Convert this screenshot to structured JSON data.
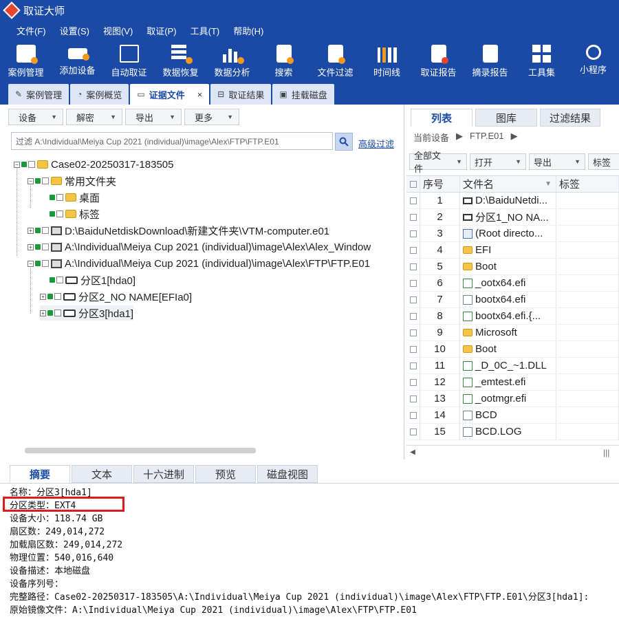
{
  "app": {
    "title": "取证大师"
  },
  "menu": [
    "文件(F)",
    "设置(S)",
    "视图(V)",
    "取证(P)",
    "工具(T)",
    "帮助(H)"
  ],
  "toolbar": [
    "案例管理",
    "添加设备",
    "自动取证",
    "数据恢复",
    "数据分析",
    "搜索",
    "文件过滤",
    "时间线",
    "取证报告",
    "摘录报告",
    "工具集",
    "小程序"
  ],
  "workspace_tabs": [
    {
      "label": "案例管理"
    },
    {
      "label": "案例概览"
    },
    {
      "label": "证据文件",
      "close": "×"
    },
    {
      "label": "取证结果"
    },
    {
      "label": "挂载磁盘"
    }
  ],
  "left": {
    "buttons": [
      "设备",
      "解密",
      "导出",
      "更多"
    ],
    "filter_text": "过滤 A:\\Individual\\Meiya Cup 2021 (individual)\\image\\Alex\\FTP\\FTP.E01",
    "advanced_filter": "高级过滤",
    "tree": [
      "Case02-20250317-183505",
      "常用文件夹",
      "桌面",
      "标签",
      "D:\\BaiduNetdiskDownload\\新建文件夹\\VTM-computer.e01",
      "A:\\Individual\\Meiya Cup 2021 (individual)\\image\\Alex\\Alex_Window",
      "A:\\Individual\\Meiya Cup 2021 (individual)\\image\\Alex\\FTP\\FTP.E01",
      "分区1[hda0]",
      "分区2_NO NAME[EFIa0]",
      "分区3[hda1]"
    ]
  },
  "right": {
    "tabs": [
      "列表",
      "图库",
      "过滤结果"
    ],
    "breadcrumb": {
      "current": "当前设备",
      "item": "FTP.E01"
    },
    "buttons": [
      "全部文件",
      "打开",
      "导出",
      "标签"
    ],
    "columns": {
      "index": "序号",
      "name": "文件名",
      "tag": "标签"
    },
    "rows": [
      {
        "n": "1",
        "name": "D:\\BaiduNetdi...",
        "icon": "disk"
      },
      {
        "n": "2",
        "name": "分区1_NO NA...",
        "icon": "disk"
      },
      {
        "n": "3",
        "name": "(Root directo...",
        "icon": "sys"
      },
      {
        "n": "4",
        "name": "EFI",
        "icon": "folder"
      },
      {
        "n": "5",
        "name": "Boot",
        "icon": "folder"
      },
      {
        "n": "6",
        "name": "_ootx64.efi",
        "icon": "exe"
      },
      {
        "n": "7",
        "name": "bootx64.efi",
        "icon": "file"
      },
      {
        "n": "8",
        "name": "bootx64.efi.{...",
        "icon": "exe"
      },
      {
        "n": "9",
        "name": "Microsoft",
        "icon": "folder"
      },
      {
        "n": "10",
        "name": "Boot",
        "icon": "folder"
      },
      {
        "n": "11",
        "name": "_D_0C_~1.DLL",
        "icon": "exe"
      },
      {
        "n": "12",
        "name": "_emtest.efi",
        "icon": "exe"
      },
      {
        "n": "13",
        "name": "_ootmgr.efi",
        "icon": "exe"
      },
      {
        "n": "14",
        "name": "BCD",
        "icon": "file"
      },
      {
        "n": "15",
        "name": "BCD.LOG",
        "icon": "file"
      }
    ]
  },
  "bottom": {
    "tabs": [
      "摘要",
      "文本",
      "十六进制",
      "预览",
      "磁盘视图"
    ],
    "lines": [
      "名称：分区3[hda1]",
      "分区类型：EXT4",
      "设备大小：118.74 GB",
      "扇区数：249,014,272",
      "加载扇区数：249,014,272",
      "物理位置：540,016,640",
      "设备描述：本地磁盘",
      "设备序列号：",
      "完整路径：Case02-20250317-183505\\A:\\Individual\\Meiya Cup 2021 (individual)\\image\\Alex\\FTP\\FTP.E01\\分区3[hda1]:",
      "原始镜像文件：A:\\Individual\\Meiya Cup 2021 (individual)\\image\\Alex\\FTP\\FTP.E01"
    ]
  },
  "colors": {
    "brand": "#1b4aa6",
    "highlight": "#e01b1b"
  }
}
